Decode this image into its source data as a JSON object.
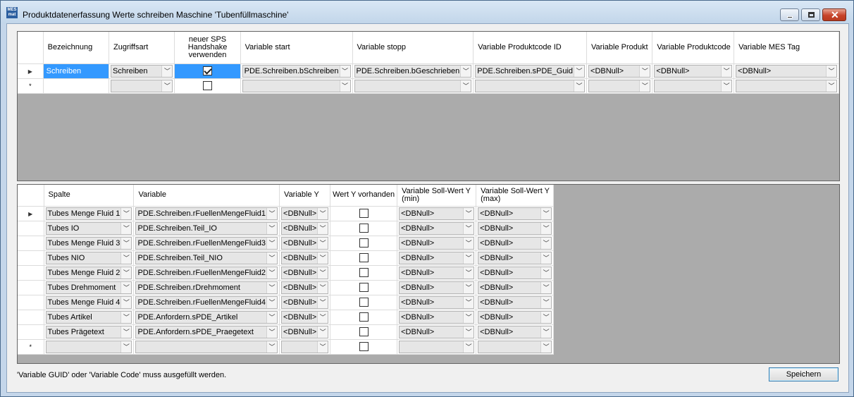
{
  "window": {
    "title": "Produktdatenerfassung Werte schreiben Maschine 'Tubenfüllmaschine'",
    "icon_label": "MES mat"
  },
  "top_grid": {
    "headers": [
      "Bezeichnung",
      "Zugriffsart",
      "neuer SPS Handshake verwenden",
      "Variable start",
      "Variable stopp",
      "Variable Produktcode ID",
      "Variable Produkt",
      "Variable Produktcode",
      "Variable MES Tag"
    ],
    "rows": [
      {
        "bezeichnung": "Schreiben",
        "zugriffsart": "Schreiben",
        "handshake": true,
        "variable_start": "PDE.Schreiben.bSchreiben",
        "variable_stopp": "PDE.Schreiben.bGeschrieben",
        "variable_produktcode_id": "PDE.Schreiben.sPDE_Guid",
        "variable_produkt": "<DBNull>",
        "variable_produktcode": "<DBNull>",
        "variable_mes_tag": "<DBNull>"
      }
    ],
    "new_row_marker": "*"
  },
  "bottom_grid": {
    "headers": [
      "Spalte",
      "Variable",
      "Variable Y",
      "Wert Y vorhanden",
      "Variable Soll-Wert Y (min)",
      "Variable Soll-Wert Y (max)"
    ],
    "rows": [
      {
        "spalte": "Tubes Menge Fluid 1",
        "variable": "PDE.Schreiben.rFuellenMengeFluid1",
        "variable_y": "<DBNull>",
        "wert_y": false,
        "soll_min": "<DBNull>",
        "soll_max": "<DBNull>"
      },
      {
        "spalte": "Tubes IO",
        "variable": "PDE.Schreiben.Teil_IO",
        "variable_y": "<DBNull>",
        "wert_y": false,
        "soll_min": "<DBNull>",
        "soll_max": "<DBNull>"
      },
      {
        "spalte": "Tubes Menge Fluid 3",
        "variable": "PDE.Schreiben.rFuellenMengeFluid3",
        "variable_y": "<DBNull>",
        "wert_y": false,
        "soll_min": "<DBNull>",
        "soll_max": "<DBNull>"
      },
      {
        "spalte": "Tubes NIO",
        "variable": "PDE.Schreiben.Teil_NIO",
        "variable_y": "<DBNull>",
        "wert_y": false,
        "soll_min": "<DBNull>",
        "soll_max": "<DBNull>"
      },
      {
        "spalte": "Tubes Menge Fluid 2",
        "variable": "PDE.Schreiben.rFuellenMengeFluid2",
        "variable_y": "<DBNull>",
        "wert_y": false,
        "soll_min": "<DBNull>",
        "soll_max": "<DBNull>"
      },
      {
        "spalte": "Tubes Drehmoment",
        "variable": "PDE.Schreiben.rDrehmoment",
        "variable_y": "<DBNull>",
        "wert_y": false,
        "soll_min": "<DBNull>",
        "soll_max": "<DBNull>"
      },
      {
        "spalte": "Tubes Menge Fluid 4",
        "variable": "PDE.Schreiben.rFuellenMengeFluid4",
        "variable_y": "<DBNull>",
        "wert_y": false,
        "soll_min": "<DBNull>",
        "soll_max": "<DBNull>"
      },
      {
        "spalte": "Tubes Artikel",
        "variable": "PDE.Anfordern.sPDE_Artikel",
        "variable_y": "<DBNull>",
        "wert_y": false,
        "soll_min": "<DBNull>",
        "soll_max": "<DBNull>"
      },
      {
        "spalte": "Tubes Prägetext",
        "variable": "PDE.Anfordern.sPDE_Praegetext",
        "variable_y": "<DBNull>",
        "wert_y": false,
        "soll_min": "<DBNull>",
        "soll_max": "<DBNull>"
      }
    ],
    "new_row_marker": "*"
  },
  "footer": {
    "message": "'Variable GUID' oder 'Variable Code' muss ausgefüllt werden.",
    "save_label": "Speichern"
  },
  "icons": {
    "row_indicator": "play-right-triangle",
    "dropdown": "chevron-down",
    "close": "x-mark"
  }
}
